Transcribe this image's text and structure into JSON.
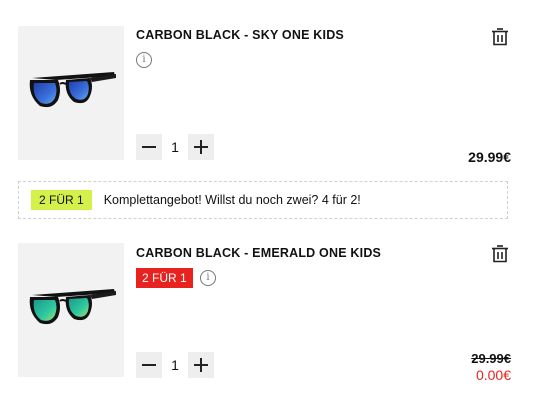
{
  "cart": {
    "items": [
      {
        "title": "CARBON BLACK - SKY ONE KIDS",
        "info_icon": "info-icon",
        "quantity": "1",
        "price": "29.99€",
        "lens_color": "#3b6fd9",
        "icon_delete": "trash-icon"
      },
      {
        "title": "CARBON BLACK - EMERALD ONE KIDS",
        "promo_badge": "2 FÜR 1",
        "promo_badge_color": "#e8221f",
        "info_icon": "info-icon",
        "quantity": "1",
        "old_price": "29.99€",
        "new_price": "0.00€",
        "new_price_color": "#e8221f",
        "lens_color": "#2fc9a0",
        "icon_delete": "trash-icon"
      }
    ],
    "bundle_offer": {
      "badge": "2 FÜR 1",
      "badge_color": "#d4f04a",
      "text": "Komplettangebot! Willst du noch zwei? 4 für 2!"
    }
  }
}
